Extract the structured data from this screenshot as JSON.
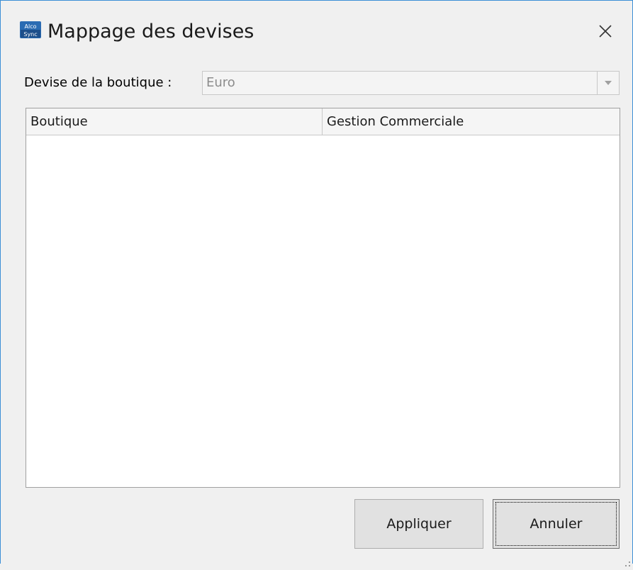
{
  "window": {
    "title": "Mappage des devises",
    "app_icon_text_top": "Alco",
    "app_icon_text_bottom": "Sync"
  },
  "form": {
    "devise_label": "Devise de la boutique :",
    "devise_value": "Euro"
  },
  "grid": {
    "columns": [
      "Boutique",
      "Gestion Commerciale"
    ],
    "rows": []
  },
  "buttons": {
    "apply_label": "Appliquer",
    "cancel_label": "Annuler"
  },
  "colors": {
    "window_border": "#3c8fd6",
    "background": "#f0f0f0",
    "disabled_text": "#8c8c8c"
  },
  "icons": {
    "app": "alcosync-app-icon",
    "close": "close-icon",
    "dropdown": "chevron-down-icon"
  }
}
